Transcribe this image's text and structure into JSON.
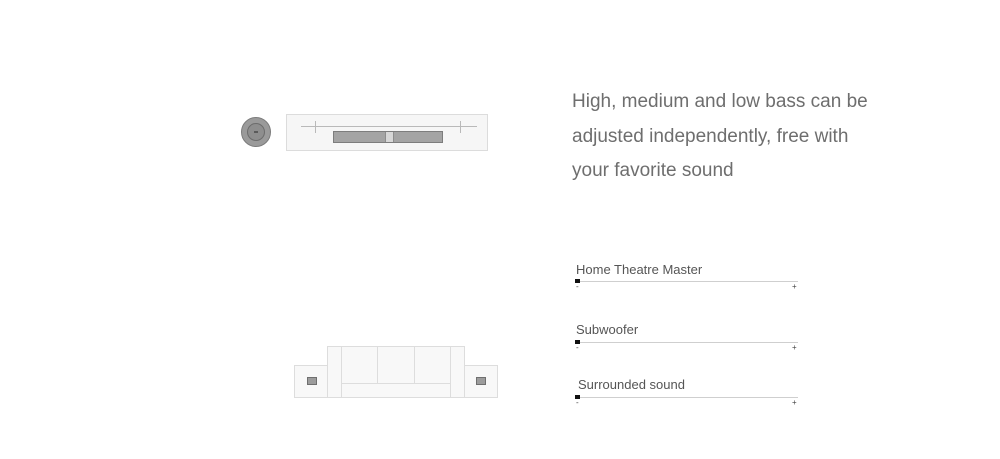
{
  "description": {
    "lines": [
      "High, medium and low bass can be",
      "adjusted independently, free with",
      "your favorite sound"
    ]
  },
  "illustrations": {
    "subwoofer_icon": "subwoofer-knob-icon",
    "soundbar_icon": "soundbar-icon",
    "sofa_icon": "sofa-icon",
    "speaker_icon": "speaker-icon"
  },
  "sliders": [
    {
      "label": "Home Theatre Master",
      "min_label": "-",
      "max_label": "+",
      "value": 0
    },
    {
      "label": "Subwoofer",
      "min_label": "-",
      "max_label": "+",
      "value": 0
    },
    {
      "label": "Surrounded sound",
      "min_label": "-",
      "max_label": "+",
      "value": 0
    }
  ],
  "colors": {
    "text": "#6e6e6e",
    "track": "#cfcfcf",
    "thumb": "#111111",
    "device_fill": "#a4a4a4"
  }
}
